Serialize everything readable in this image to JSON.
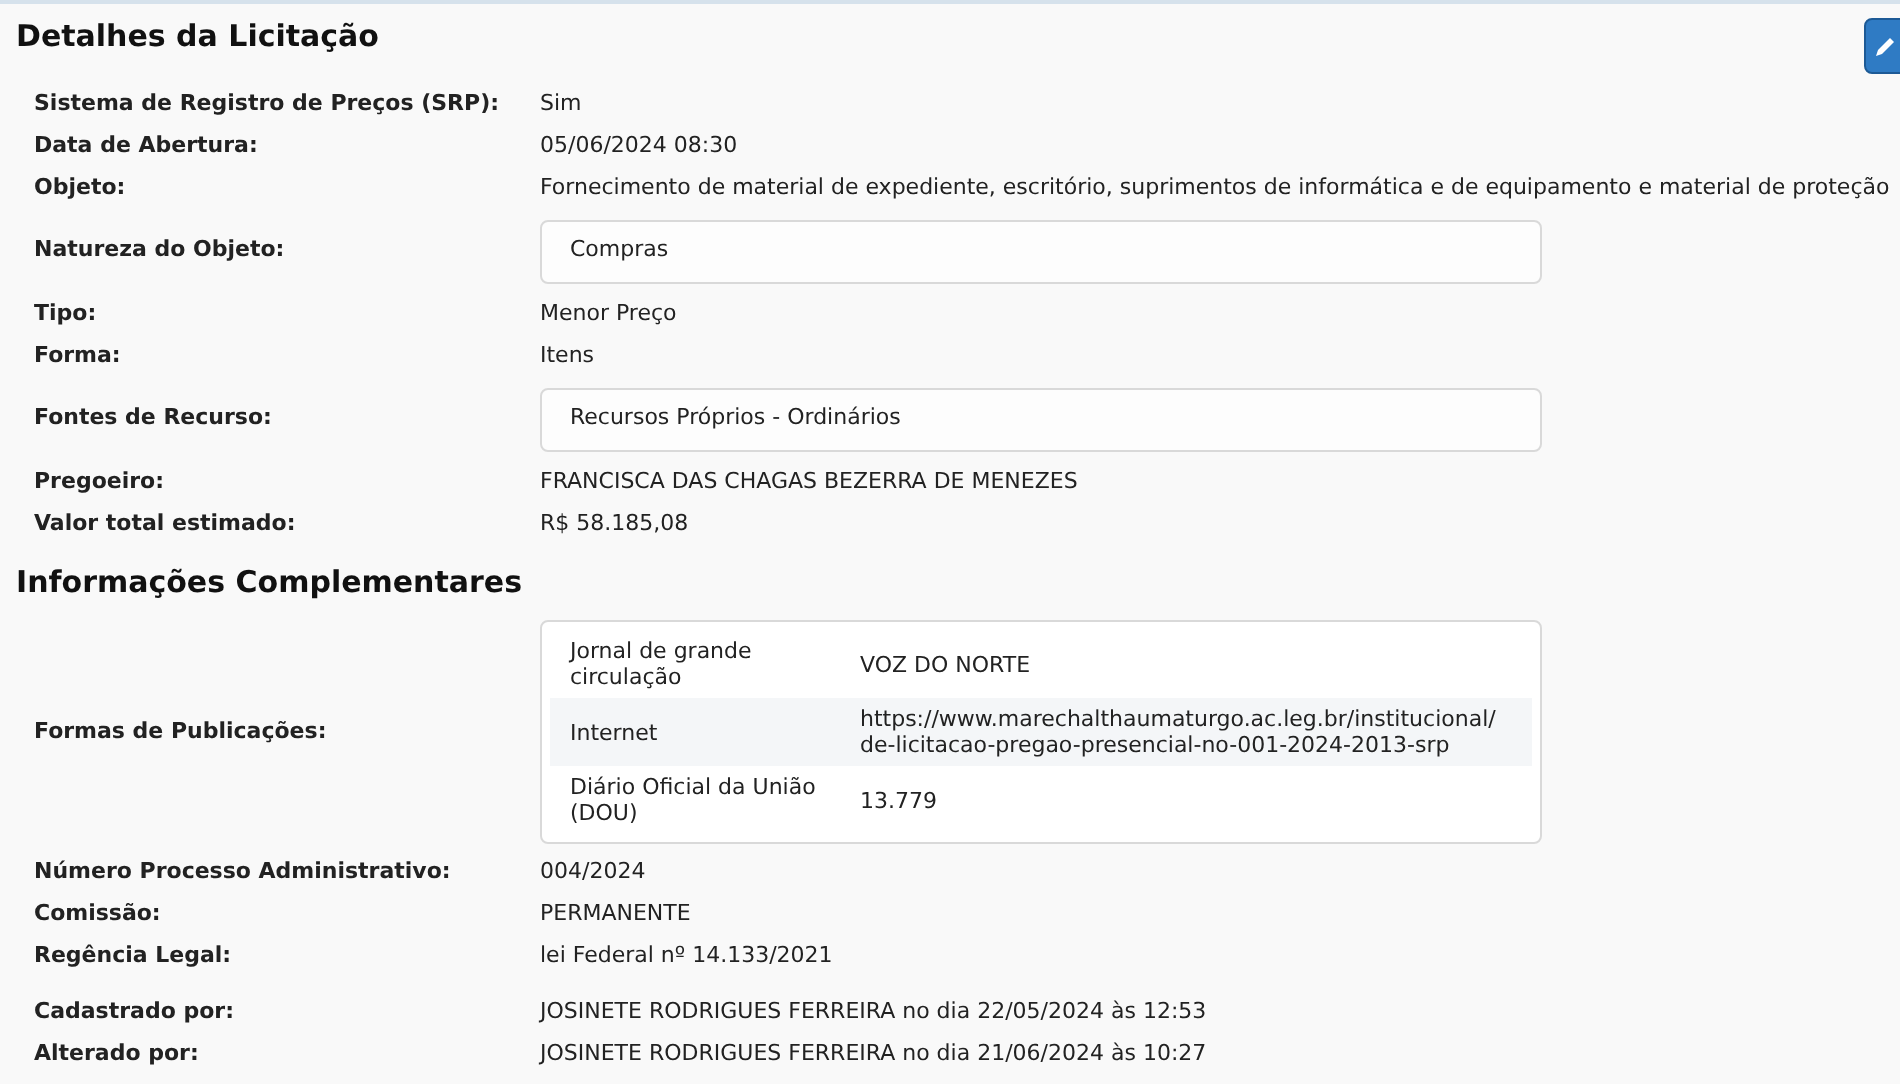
{
  "sections": [
    {
      "title": "Detalhes da Licitação",
      "rows": [
        {
          "kind": "text",
          "label": "Sistema de Registro de Preços (SRP):",
          "value": "Sim"
        },
        {
          "kind": "text",
          "label": "Data de Abertura:",
          "value": "05/06/2024 08:30"
        },
        {
          "kind": "text",
          "label": "Objeto:",
          "value": "Fornecimento de material de expediente, escritório, suprimentos de informática e de equipamento e material de proteção"
        },
        {
          "kind": "box",
          "label": "Natureza do Objeto:",
          "value": "Compras"
        },
        {
          "kind": "text",
          "label": "Tipo:",
          "value": "Menor Preço"
        },
        {
          "kind": "text",
          "label": "Forma:",
          "value": "Itens"
        },
        {
          "kind": "box",
          "label": "Fontes de Recurso:",
          "value": "Recursos Próprios - Ordinários"
        },
        {
          "kind": "text",
          "label": "Pregoeiro:",
          "value": "FRANCISCA DAS CHAGAS BEZERRA DE MENEZES"
        },
        {
          "kind": "text",
          "label": "Valor total estimado:",
          "value": "R$ 58.185,08"
        }
      ]
    },
    {
      "title": "Informações Complementares",
      "rows": [
        {
          "kind": "table",
          "label": "Formas de Publicações:",
          "items": [
            {
              "name": "Jornal de grande circulação",
              "lines": [
                "VOZ DO NORTE"
              ]
            },
            {
              "name": "Internet",
              "lines": [
                "https://www.marechalthaumaturgo.ac.leg.br/institucional/",
                "de-licitacao-pregao-presencial-no-001-2024-2013-srp"
              ]
            },
            {
              "name": "Diário Oficial da União (DOU)",
              "lines": [
                "13.779"
              ]
            }
          ]
        },
        {
          "kind": "text",
          "label": "Número Processo Administrativo:",
          "value": "004/2024"
        },
        {
          "kind": "text",
          "label": "Comissão:",
          "value": "PERMANENTE"
        },
        {
          "kind": "text",
          "label": "Regência Legal:",
          "value": "lei Federal nº 14.133/2021"
        },
        {
          "kind": "spacer"
        },
        {
          "kind": "text",
          "label": "Cadastrado por:",
          "value": "JOSINETE RODRIGUES FERREIRA no dia 22/05/2024 às 12:53"
        },
        {
          "kind": "text",
          "label": "Alterado por:",
          "value": "JOSINETE RODRIGUES FERREIRA no dia 21/06/2024 às 10:27"
        }
      ]
    }
  ]
}
